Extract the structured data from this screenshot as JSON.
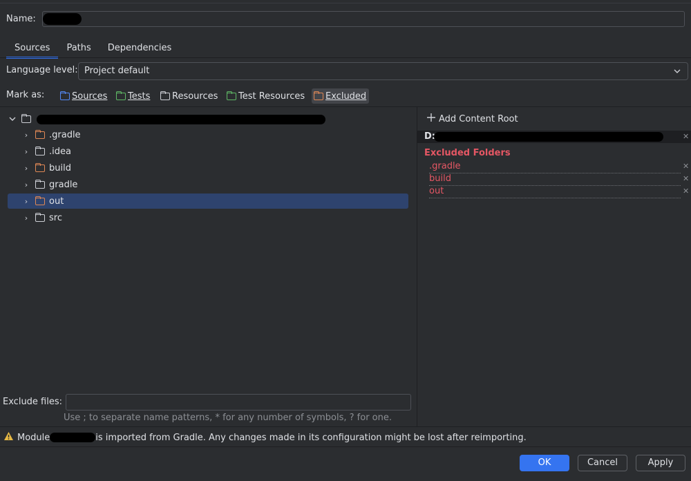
{
  "name": {
    "label": "Name:",
    "value": ""
  },
  "tabs": [
    {
      "label": "Sources",
      "active": true
    },
    {
      "label": "Paths",
      "active": false
    },
    {
      "label": "Dependencies",
      "active": false
    }
  ],
  "language_level": {
    "label": "Language level:",
    "value": "Project default"
  },
  "mark_as": {
    "label": "Mark as:",
    "buttons": [
      {
        "label": "Sources",
        "color": "#548af7",
        "selected": false
      },
      {
        "label": "Tests",
        "color": "#5fb865",
        "selected": false
      },
      {
        "label": "Resources",
        "color": "#ced0d6",
        "selected": false
      },
      {
        "label": "Test Resources",
        "color": "#5fb865",
        "selected": false
      },
      {
        "label": "Excluded",
        "color": "#e08855",
        "selected": true
      }
    ]
  },
  "tree": {
    "root_label": "",
    "items": [
      {
        "label": ".gradle",
        "excluded": true,
        "selected": false
      },
      {
        "label": ".idea",
        "excluded": false,
        "selected": false
      },
      {
        "label": "build",
        "excluded": true,
        "selected": false
      },
      {
        "label": "gradle",
        "excluded": false,
        "selected": false
      },
      {
        "label": "out",
        "excluded": true,
        "selected": true
      },
      {
        "label": "src",
        "excluded": false,
        "selected": false
      }
    ]
  },
  "content_root": {
    "add_label": "Add Content Root",
    "path_prefix": "D:",
    "excluded_title": "Excluded Folders",
    "excluded": [
      ".gradle",
      "build",
      "out"
    ]
  },
  "exclude_files": {
    "label": "Exclude files:",
    "value": "",
    "hint": "Use ; to separate name patterns, * for any number of symbols, ? for one."
  },
  "warning": {
    "prefix": "Module",
    "suffix": "is imported from Gradle. Any changes made in its configuration might be lost after reimporting."
  },
  "buttons": {
    "ok": "OK",
    "cancel": "Cancel",
    "apply": "Apply"
  },
  "colors": {
    "accent": "#3574f0",
    "excluded": "#e55764",
    "selection": "#2e436e"
  }
}
